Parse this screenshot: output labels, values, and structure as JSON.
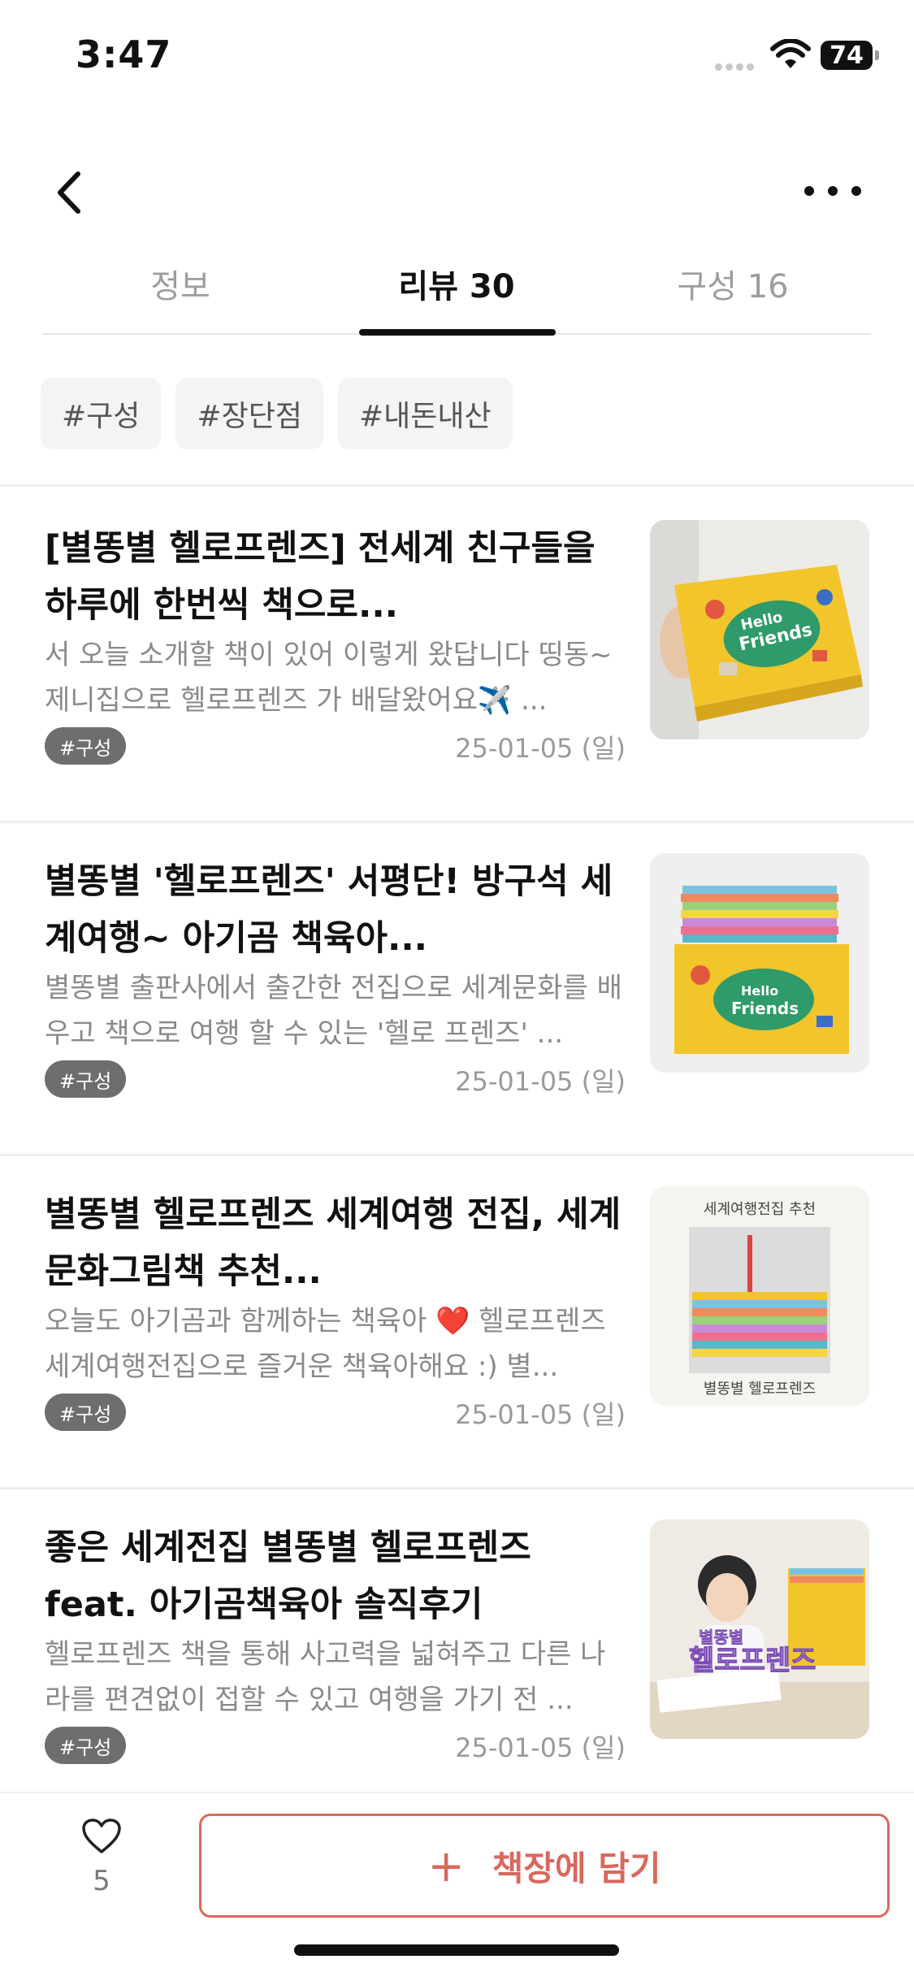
{
  "status": {
    "time": "3:47",
    "battery": "74"
  },
  "tabs": [
    {
      "label": "정보"
    },
    {
      "label": "리뷰 30"
    },
    {
      "label": "구성 16"
    }
  ],
  "hashtags": [
    "#구성",
    "#장단점",
    "#내돈내산"
  ],
  "reviews": [
    {
      "title": "[별똥별 헬로프렌즈]  전세계 친구들을 하루에 한번씩 책으로...",
      "excerpt": "서 오늘 소개할 책이 있어 이렇게 왔답니다  띵동~ 제니집으로 헬로프렌즈 가 배달왔어요✈️ ...",
      "badge": "#구성",
      "date": "25-01-05 (일)"
    },
    {
      "title": "별똥별 '헬로프렌즈' 서평단! 방구석 세계여행~ 아기곰 책육아...",
      "excerpt": "별똥별 출판사에서 출간한 전집으로 세계문화를 배우고 책으로 여행 할 수 있는 '헬로 프렌즈' ...",
      "badge": "#구성",
      "date": "25-01-05 (일)"
    },
    {
      "title": "별똥별 헬로프렌즈 세계여행 전집, 세계문화그림책 추천...",
      "excerpt": "오늘도 아기곰과 함께하는 책육아 ❤️  헬로프렌즈 세계여행전집으로 즐거운 책육아해요 :) 별...",
      "badge": "#구성",
      "date": "25-01-05 (일)",
      "thumb_text_top": "세계여행전집 추천",
      "thumb_text_bottom": "별똥별 헬로프렌즈"
    },
    {
      "title": "좋은 세계전집 별똥별 헬로프렌즈 feat. 아기곰책육아 솔직후기",
      "excerpt": "헬로프렌즈 책을 통해 사고력을 넓혀주고 다른 나라를 편견없이 접할 수 있고 여행을 가기 전 ...",
      "badge": "#구성",
      "date": "25-01-05 (일)",
      "thumb_text_top": "별똥별",
      "thumb_text_bottom": "헬로프렌즈"
    }
  ],
  "box_label": {
    "line1": "Hello",
    "line2": "Friends"
  },
  "bottom": {
    "like_count": "5",
    "add_label": "책장에 담기"
  },
  "colors": {
    "accent": "#d9685e",
    "tab_active": "#111111",
    "tab_inactive": "#9d9d9d",
    "box_yellow": "#f2c52b",
    "box_green": "#2f9a6a"
  }
}
